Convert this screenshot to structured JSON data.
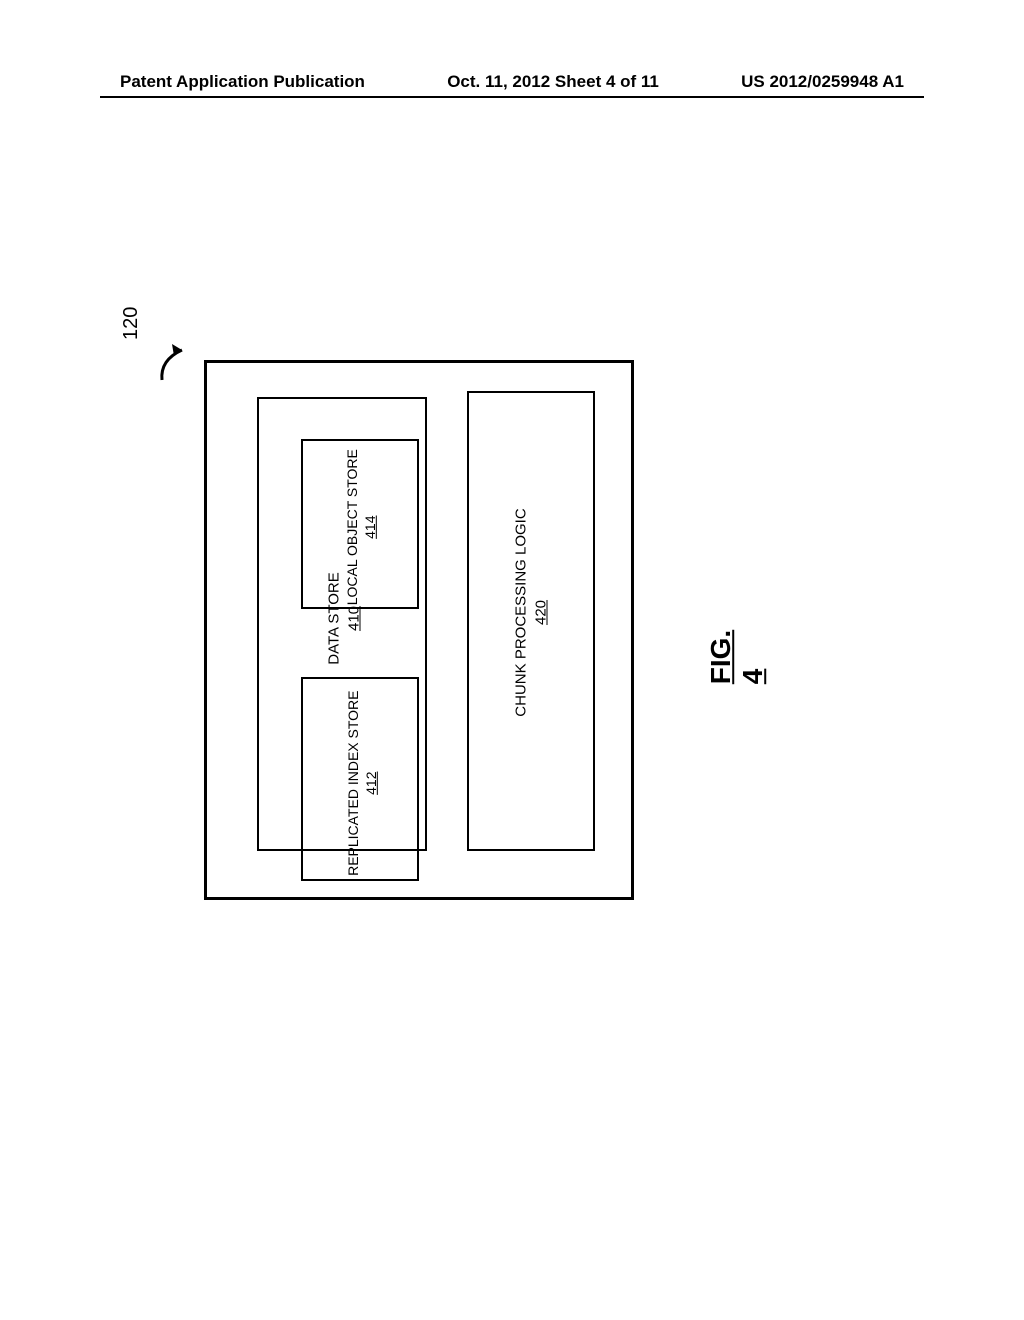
{
  "header": {
    "left": "Patent Application Publication",
    "center": "Oct. 11, 2012  Sheet 4 of 11",
    "right": "US 2012/0259948 A1"
  },
  "diagram": {
    "ref_number": "120",
    "data_store": {
      "title": "DATA STORE",
      "number": "410"
    },
    "replicated_index": {
      "title": "REPLICATED INDEX STORE",
      "number": "412"
    },
    "local_object": {
      "title": "LOCAL OBJECT STORE",
      "number": "414"
    },
    "chunk_processing": {
      "title": "CHUNK PROCESSING LOGIC",
      "number": "420"
    },
    "figure_label": "FIG. 4"
  }
}
